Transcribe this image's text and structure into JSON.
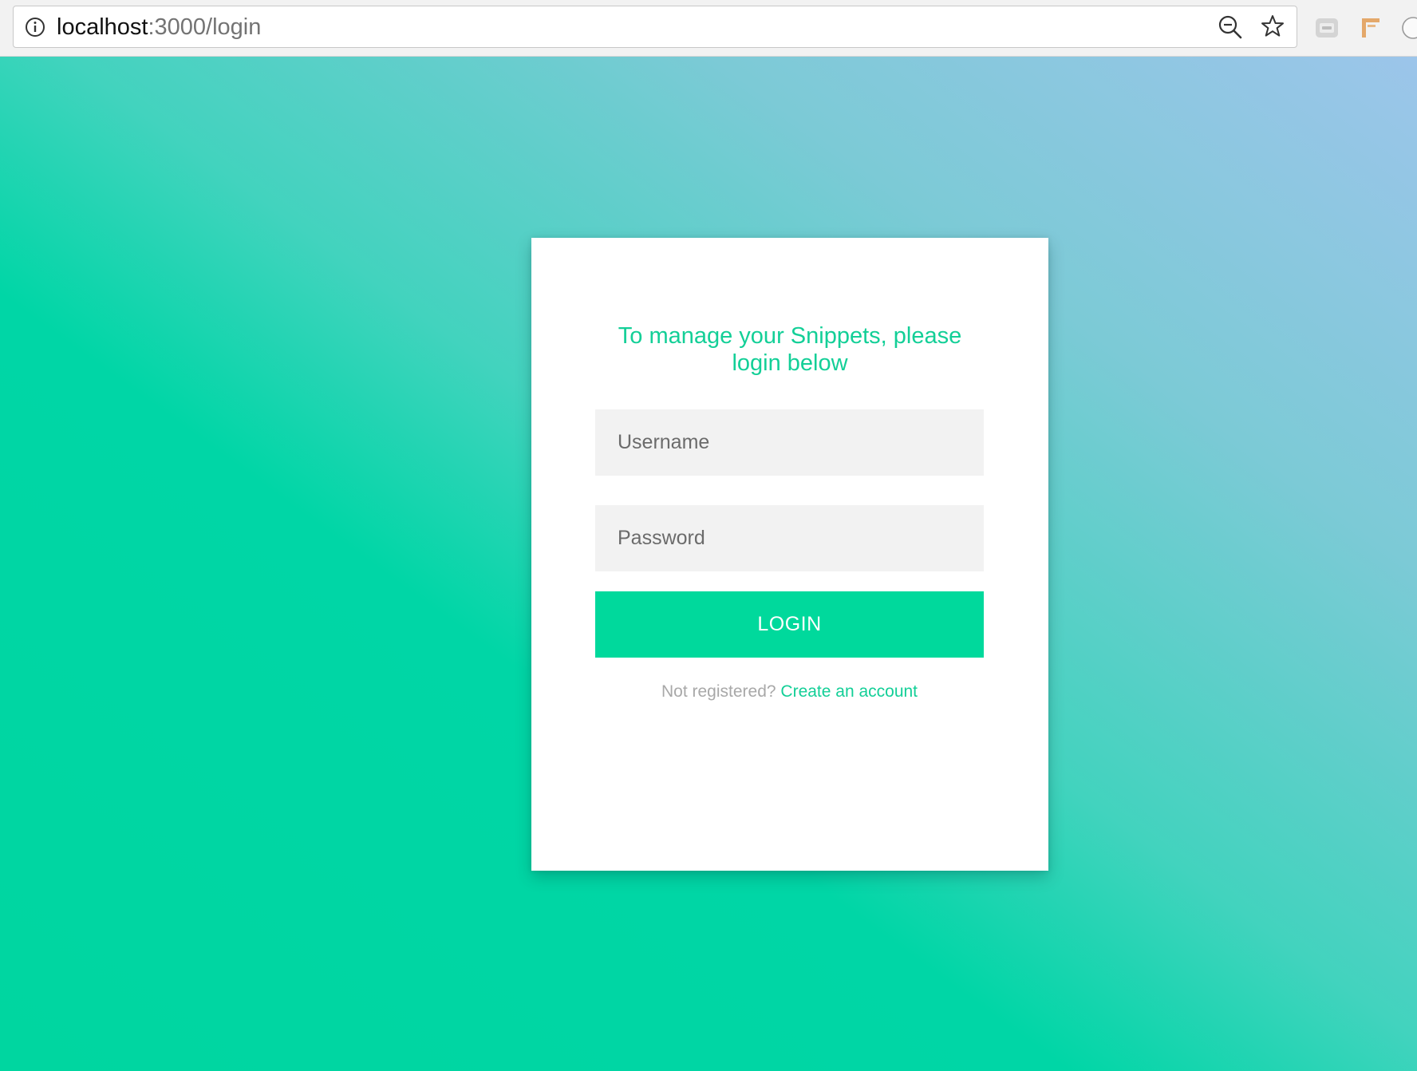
{
  "browser": {
    "url_host": "localhost",
    "url_path": ":3000/login",
    "icons": [
      "info-icon",
      "zoom-out-icon",
      "bookmark-star-icon",
      "extension-icon",
      "extension-icon",
      "extension-icon"
    ]
  },
  "login": {
    "heading": "To manage your Snippets, please login below",
    "username_placeholder": "Username",
    "password_placeholder": "Password",
    "button_label": "LOGIN",
    "register_prompt": "Not registered?",
    "register_link": "Create an account"
  },
  "colors": {
    "accent": "#13cf97",
    "button": "#00d99c",
    "gradient_start": "#00d6a0",
    "gradient_end": "#9cc5ea",
    "input_bg": "#f2f2f2"
  }
}
